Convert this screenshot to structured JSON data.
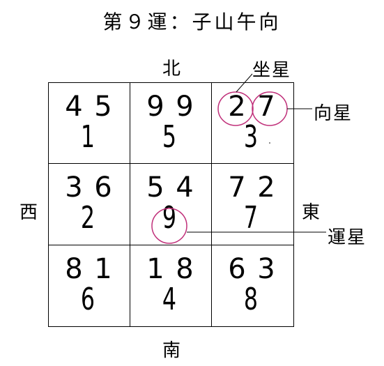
{
  "title": "第９運：子山午向",
  "directions": {
    "north": "北",
    "south": "南",
    "west": "西",
    "east": "東"
  },
  "labels": {
    "mountain_star": "坐星",
    "facing_star": "向星",
    "period_star": "運星"
  },
  "highlight_color": "#c0307a",
  "grid": [
    {
      "mountain": "4",
      "facing": "5",
      "period": "1"
    },
    {
      "mountain": "9",
      "facing": "9",
      "period": "5"
    },
    {
      "mountain": "2",
      "facing": "7",
      "period": "3"
    },
    {
      "mountain": "3",
      "facing": "6",
      "period": "2"
    },
    {
      "mountain": "5",
      "facing": "4",
      "period": "9"
    },
    {
      "mountain": "7",
      "facing": "2",
      "period": "7"
    },
    {
      "mountain": "8",
      "facing": "1",
      "period": "6"
    },
    {
      "mountain": "1",
      "facing": "8",
      "period": "4"
    },
    {
      "mountain": "6",
      "facing": "3",
      "period": "8"
    }
  ]
}
